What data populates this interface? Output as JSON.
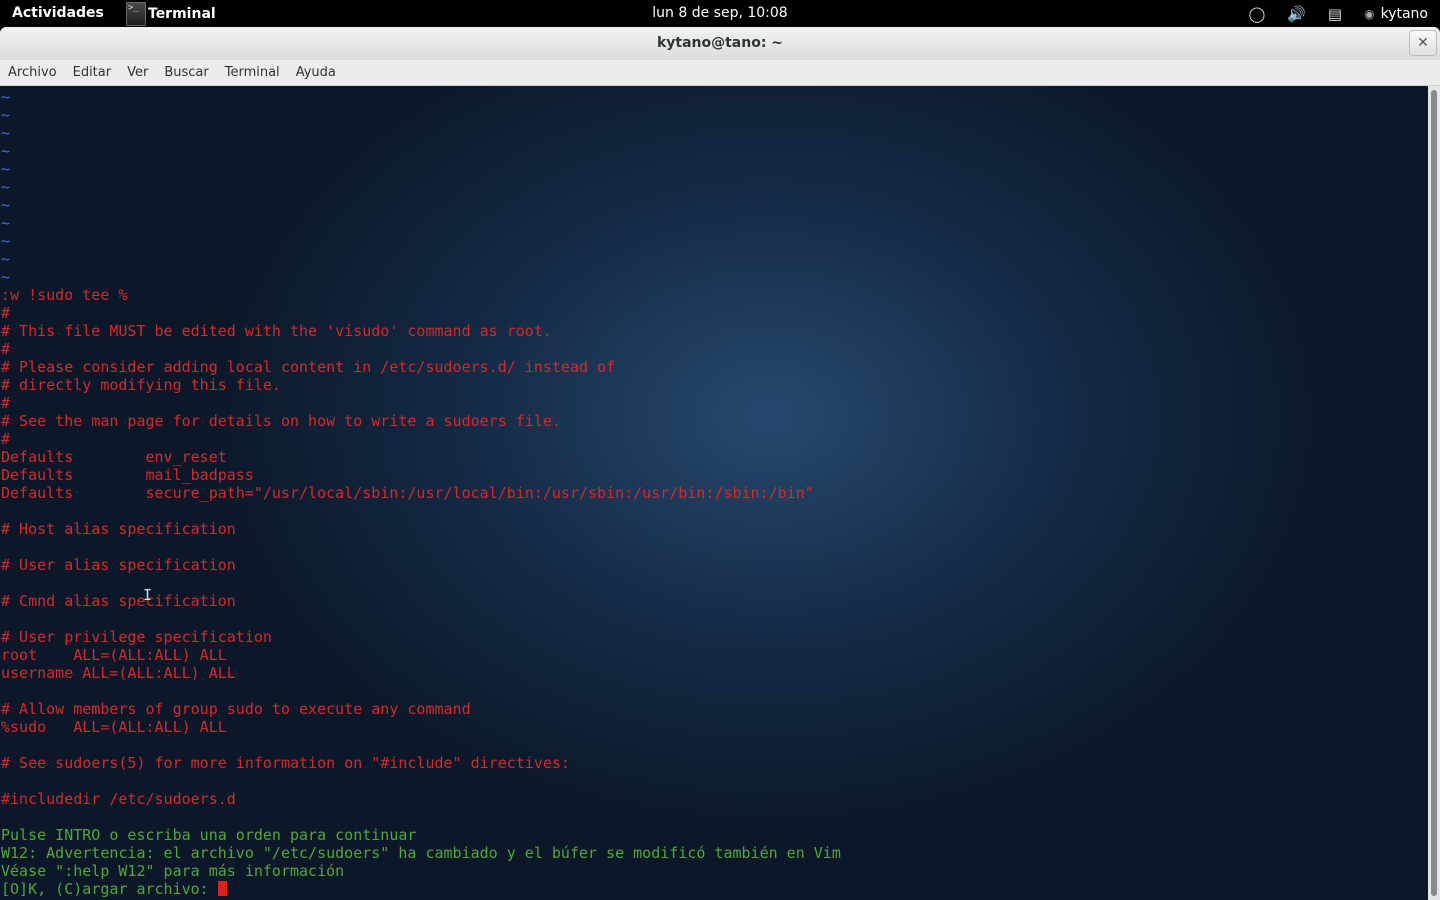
{
  "topbar": {
    "activities": "Actividades",
    "app_name": "Terminal",
    "app_icon_glyph": ">_",
    "clock": "lun  8 de sep, 10:08",
    "username": "kytano",
    "icons": [
      "accessibility-icon",
      "volume-icon",
      "network-icon",
      "user-status-icon"
    ]
  },
  "window": {
    "title": "kytano@tano: ~",
    "close_glyph": "✕"
  },
  "menu": {
    "items": [
      "Archivo",
      "Editar",
      "Ver",
      "Buscar",
      "Terminal",
      "Ayuda"
    ]
  },
  "terminal": {
    "tilde_count": 11,
    "tilde": "~",
    "lines": [
      {
        "text": ":w !sudo tee %",
        "style": "red"
      },
      {
        "text": "#",
        "style": "red"
      },
      {
        "text": "# This file MUST be edited with the 'visudo' command as root.",
        "style": "red"
      },
      {
        "text": "#",
        "style": "red"
      },
      {
        "text": "# Please consider adding local content in /etc/sudoers.d/ instead of",
        "style": "red"
      },
      {
        "text": "# directly modifying this file.",
        "style": "red"
      },
      {
        "text": "#",
        "style": "red"
      },
      {
        "text": "# See the man page for details on how to write a sudoers file.",
        "style": "red"
      },
      {
        "text": "#",
        "style": "red"
      },
      {
        "text": "Defaults        env_reset",
        "style": "red"
      },
      {
        "text": "Defaults        mail_badpass",
        "style": "red"
      },
      {
        "text": "Defaults        secure_path=\"/usr/local/sbin:/usr/local/bin:/usr/sbin:/usr/bin:/sbin:/bin\"",
        "style": "red"
      },
      {
        "text": "",
        "style": "red"
      },
      {
        "text": "# Host alias specification",
        "style": "red"
      },
      {
        "text": "",
        "style": "red"
      },
      {
        "text": "# User alias specification",
        "style": "red"
      },
      {
        "text": "",
        "style": "red"
      },
      {
        "text": "# Cmnd alias specification",
        "style": "red"
      },
      {
        "text": "",
        "style": "red"
      },
      {
        "text": "# User privilege specification",
        "style": "red"
      },
      {
        "text": "root    ALL=(ALL:ALL) ALL",
        "style": "red"
      },
      {
        "text": "username ALL=(ALL:ALL) ALL",
        "style": "red"
      },
      {
        "text": "",
        "style": "red"
      },
      {
        "text": "# Allow members of group sudo to execute any command",
        "style": "red"
      },
      {
        "text": "%sudo   ALL=(ALL:ALL) ALL",
        "style": "red"
      },
      {
        "text": "",
        "style": "red"
      },
      {
        "text": "# See sudoers(5) for more information on \"#include\" directives:",
        "style": "red"
      },
      {
        "text": "",
        "style": "red"
      },
      {
        "text": "#includedir /etc/sudoers.d",
        "style": "red"
      },
      {
        "text": "",
        "style": "red"
      },
      {
        "text": "Pulse INTRO o escriba una orden para continuar",
        "style": "green"
      },
      {
        "text": "W12: Advertencia: el archivo \"/etc/sudoers\" ha cambiado y el búfer se modificó también en Vim",
        "style": "green"
      },
      {
        "text": "Véase \":help W12\" para más información",
        "style": "green"
      }
    ],
    "prompt": "[O]K, (C)argar archivo: "
  }
}
